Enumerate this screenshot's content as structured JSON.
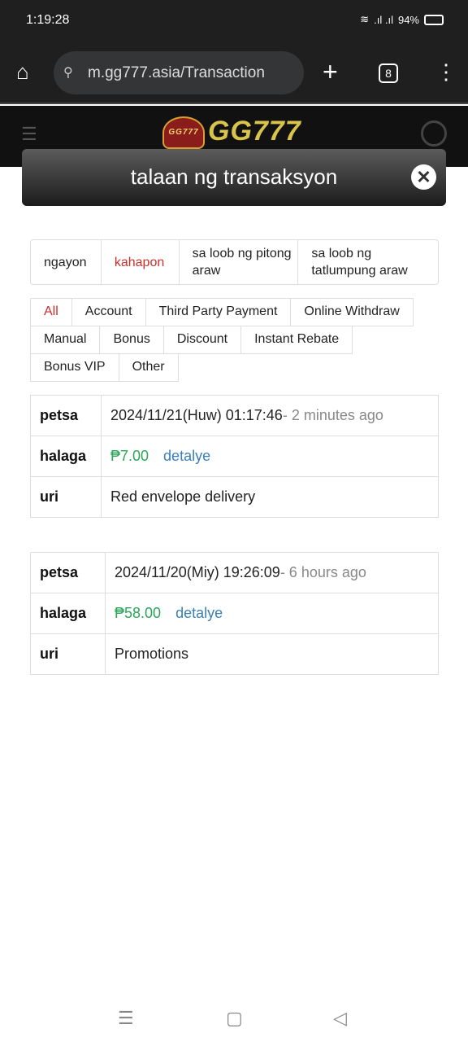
{
  "status_bar": {
    "time": "1:19:28",
    "battery": "94%"
  },
  "browser": {
    "url": "m.gg777.asia/Transaction",
    "tab_count": "8"
  },
  "header": {
    "logo_text": "GG777",
    "logo_badge": "GG777 777"
  },
  "modal": {
    "title": "talaan ng transaksyon"
  },
  "date_tabs": [
    {
      "label": "ngayon"
    },
    {
      "label": "kahapon",
      "active": true
    },
    {
      "label": "sa loob ng pitong araw"
    },
    {
      "label": "sa loob ng tatlumpung araw"
    }
  ],
  "filters": [
    [
      "All",
      "Account",
      "Third Party Payment",
      "Online Withdraw"
    ],
    [
      "Manual",
      "Bonus",
      "Discount",
      "Instant Rebate"
    ],
    [
      "Bonus VIP",
      "Other"
    ]
  ],
  "accent_color": "#c9302c",
  "records": [
    {
      "date_label": "petsa",
      "date": "2024/11/21(Huw) 01:17:46",
      "ago": "- 2 minutes ago",
      "amount_label": "halaga",
      "amount": "₱7.00",
      "detail": "detalye",
      "type_label": "uri",
      "type": "Red envelope delivery"
    },
    {
      "date_label": "petsa",
      "date": "2024/11/20(Miy) 19:26:09",
      "ago": "- 6 hours ago",
      "amount_label": "halaga",
      "amount": "₱58.00",
      "detail": "detalye",
      "type_label": "uri",
      "type": "Promotions"
    }
  ]
}
